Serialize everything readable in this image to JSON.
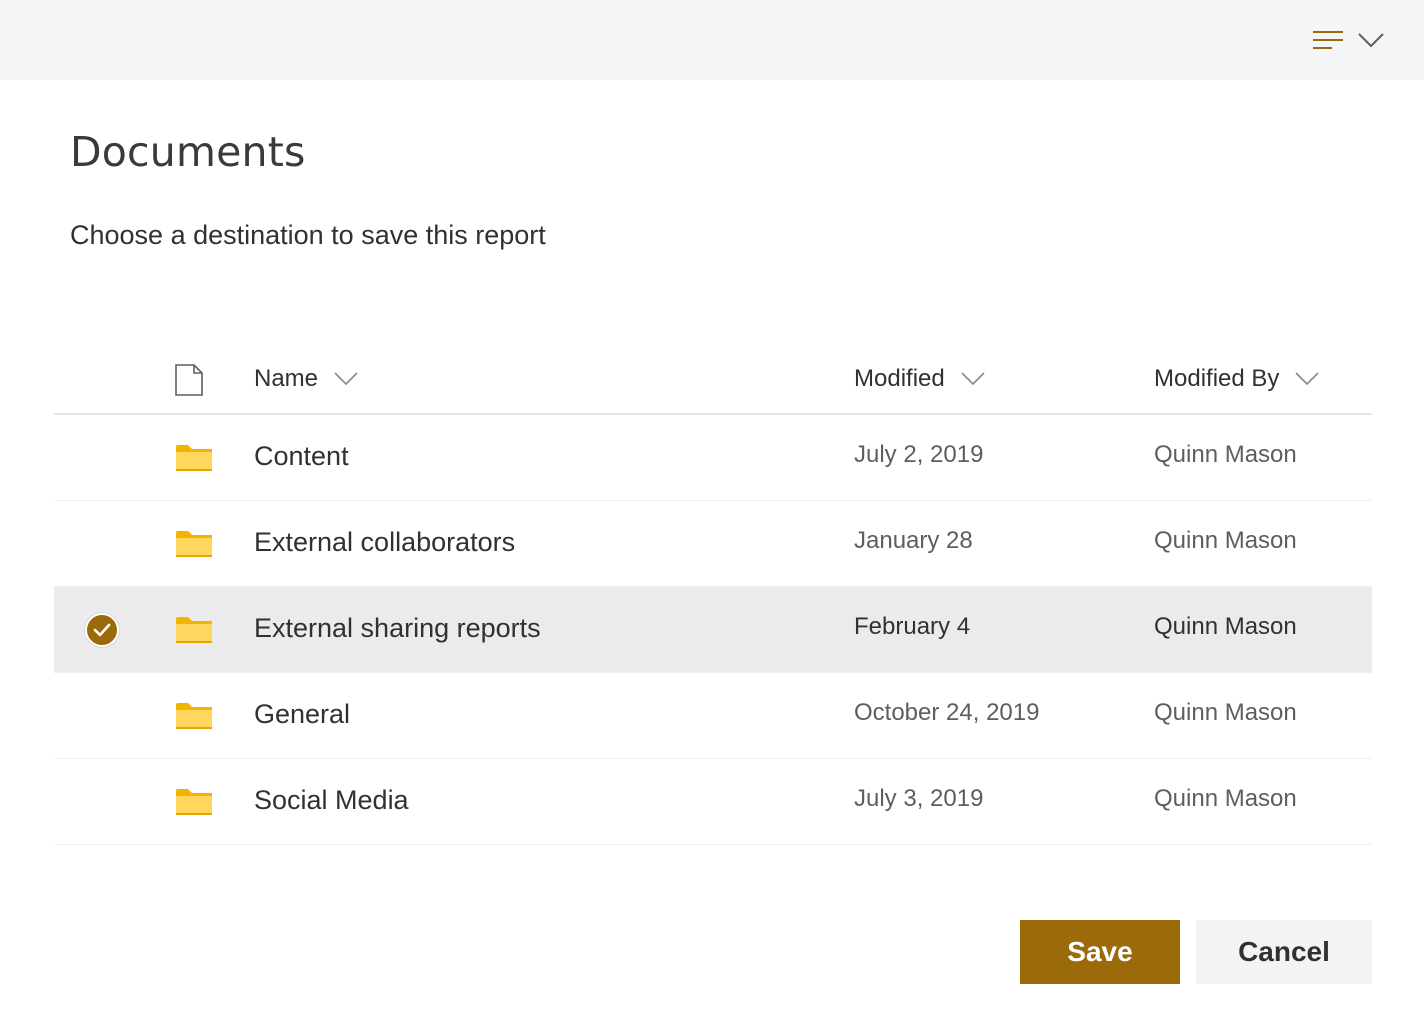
{
  "header": {
    "title": "Documents",
    "subtitle": "Choose a destination to save this report"
  },
  "table": {
    "columns": {
      "name": "Name",
      "modified": "Modified",
      "modified_by": "Modified By"
    },
    "rows": [
      {
        "name": "Content",
        "modified": "July 2, 2019",
        "modified_by": "Quinn Mason",
        "selected": false
      },
      {
        "name": "External collaborators",
        "modified": "January 28",
        "modified_by": "Quinn Mason",
        "selected": false
      },
      {
        "name": "External sharing reports",
        "modified": "February 4",
        "modified_by": "Quinn Mason",
        "selected": true
      },
      {
        "name": "General",
        "modified": "October 24, 2019",
        "modified_by": "Quinn Mason",
        "selected": false
      },
      {
        "name": "Social Media",
        "modified": "July 3, 2019",
        "modified_by": "Quinn Mason",
        "selected": false
      }
    ]
  },
  "actions": {
    "save_label": "Save",
    "cancel_label": "Cancel"
  },
  "colors": {
    "accent": "#9b6a0b",
    "folder": "#ffd75e",
    "folder_tab": "#f2b400",
    "selected_row": "#ebeaec",
    "topbar": "#f5f4f6"
  },
  "icons": {
    "view_options": "lines-icon",
    "view_dropdown": "chevron-down-icon",
    "file_type": "document-icon",
    "folder": "folder-icon",
    "selected": "checkmark-icon"
  }
}
